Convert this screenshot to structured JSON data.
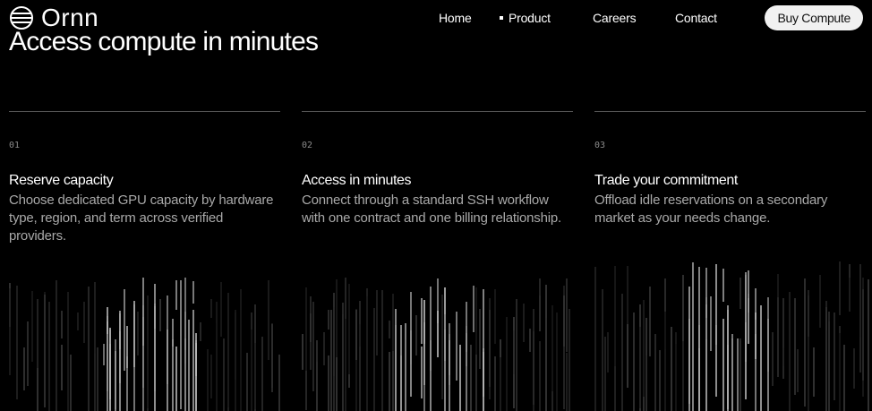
{
  "brand": {
    "name": "Ornn"
  },
  "nav": {
    "home": "Home",
    "product": "Product",
    "careers": "Careers",
    "contact": "Contact",
    "cta": "Buy Compute"
  },
  "hero": {
    "title": "Access compute in minutes"
  },
  "features": [
    {
      "num": "01",
      "title": "Reserve capacity",
      "desc": "Choose dedicated GPU capacity by hardware type, region, and term across verified providers."
    },
    {
      "num": "02",
      "title": "Access in minutes",
      "desc": "Connect through a standard SSH workflow with one contract and one billing relationship."
    },
    {
      "num": "03",
      "title": "Trade your commitment",
      "desc": "Offload idle reservations on a secondary market as your needs change."
    }
  ],
  "colors": {
    "background": "#000000",
    "text": "#ffffff",
    "muted": "#a9a9a9",
    "cta_bg": "#f1f1f1"
  }
}
